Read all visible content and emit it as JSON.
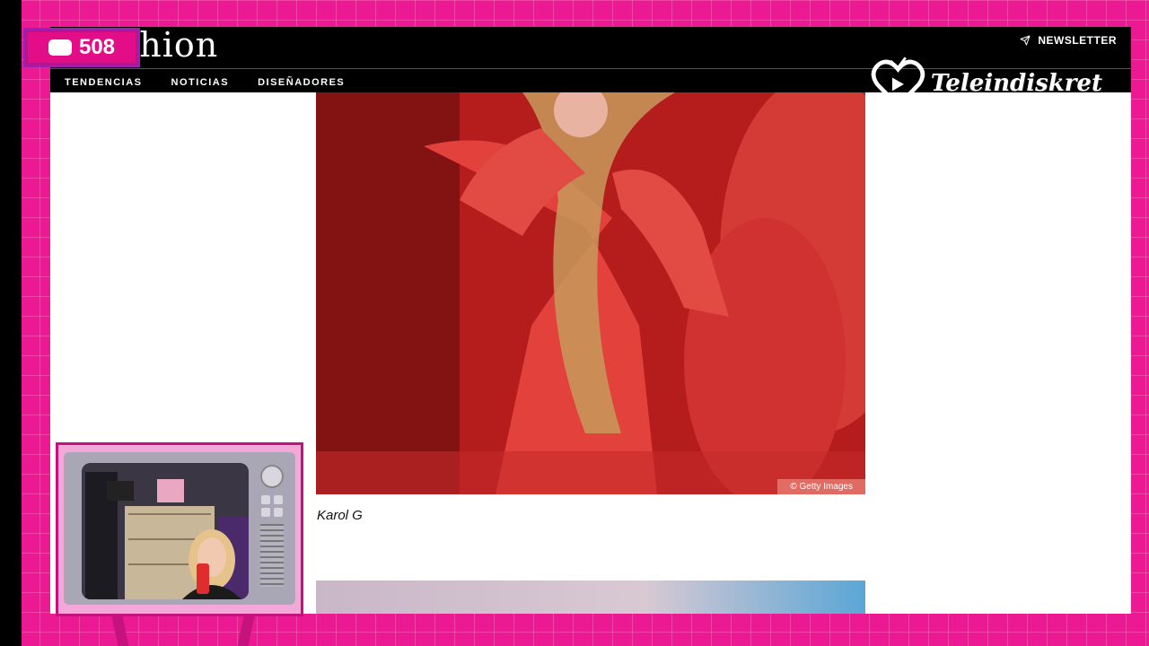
{
  "viewer_count": "508",
  "site": {
    "logo": "fashion",
    "newsletter_label": "NEWSLETTER",
    "nav": [
      "TENDENCIAS",
      "NOTICIAS",
      "DISEÑADORES"
    ]
  },
  "article": {
    "photo_credit": "© Getty Images",
    "caption": "Karol G"
  },
  "channel": {
    "name": "Teleindiskret"
  },
  "colors": {
    "frame_pink": "#ec1a92",
    "header_black": "#000000",
    "photo_red": "#c8201f"
  }
}
